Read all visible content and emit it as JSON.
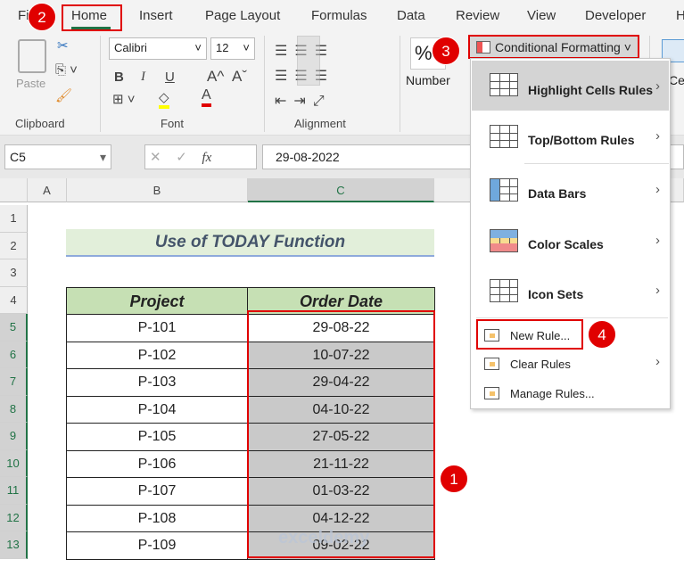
{
  "tabs": [
    "Fi",
    "Home",
    "Insert",
    "Page Layout",
    "Formulas",
    "Data",
    "Review",
    "View",
    "Developer",
    "H"
  ],
  "ribbon": {
    "clipboard": {
      "paste": "Paste",
      "label": "Clipboard"
    },
    "font": {
      "name": "Calibri",
      "size": "12",
      "bold": "B",
      "italic": "I",
      "underline": "U",
      "grow": "A^",
      "shrink": "Aˇ",
      "label": "Font"
    },
    "alignment": {
      "label": "Alignment"
    },
    "number": {
      "symbol": "%",
      "label": "Number"
    },
    "conditional_formatting": "Conditional Formatting",
    "cells_partial": "Cell"
  },
  "formula_bar": {
    "name_box": "C5",
    "fx": "fx",
    "value": "29-08-2022"
  },
  "columns": [
    "A",
    "B",
    "C"
  ],
  "rows": [
    "1",
    "2",
    "3",
    "4",
    "5",
    "6",
    "7",
    "8",
    "9",
    "10",
    "11",
    "12",
    "13"
  ],
  "sheet": {
    "title": "Use of TODAY Function",
    "headers": [
      "Project",
      "Order Date"
    ],
    "data": [
      [
        "P-101",
        "29-08-22"
      ],
      [
        "P-102",
        "10-07-22"
      ],
      [
        "P-103",
        "29-04-22"
      ],
      [
        "P-104",
        "04-10-22"
      ],
      [
        "P-105",
        "27-05-22"
      ],
      [
        "P-106",
        "21-11-22"
      ],
      [
        "P-107",
        "01-03-22"
      ],
      [
        "P-108",
        "04-12-22"
      ],
      [
        "P-109",
        "09-02-22"
      ]
    ]
  },
  "menu": {
    "items": [
      {
        "label": "Highlight Cells Rules"
      },
      {
        "label": "Top/Bottom Rules"
      },
      {
        "label": "Data Bars"
      },
      {
        "label": "Color Scales"
      },
      {
        "label": "Icon Sets"
      }
    ],
    "small_items": [
      {
        "label": "New Rule..."
      },
      {
        "label": "Clear Rules"
      },
      {
        "label": "Manage Rules..."
      }
    ]
  },
  "badges": [
    "1",
    "2",
    "3",
    "4"
  ],
  "watermark": "exceldemy",
  "colors": {
    "accent_red": "#e00000",
    "header_green": "#c6e0b4",
    "title_bg": "#e2efda",
    "selection_gray": "#c9c9c9",
    "excel_green": "#217346"
  }
}
